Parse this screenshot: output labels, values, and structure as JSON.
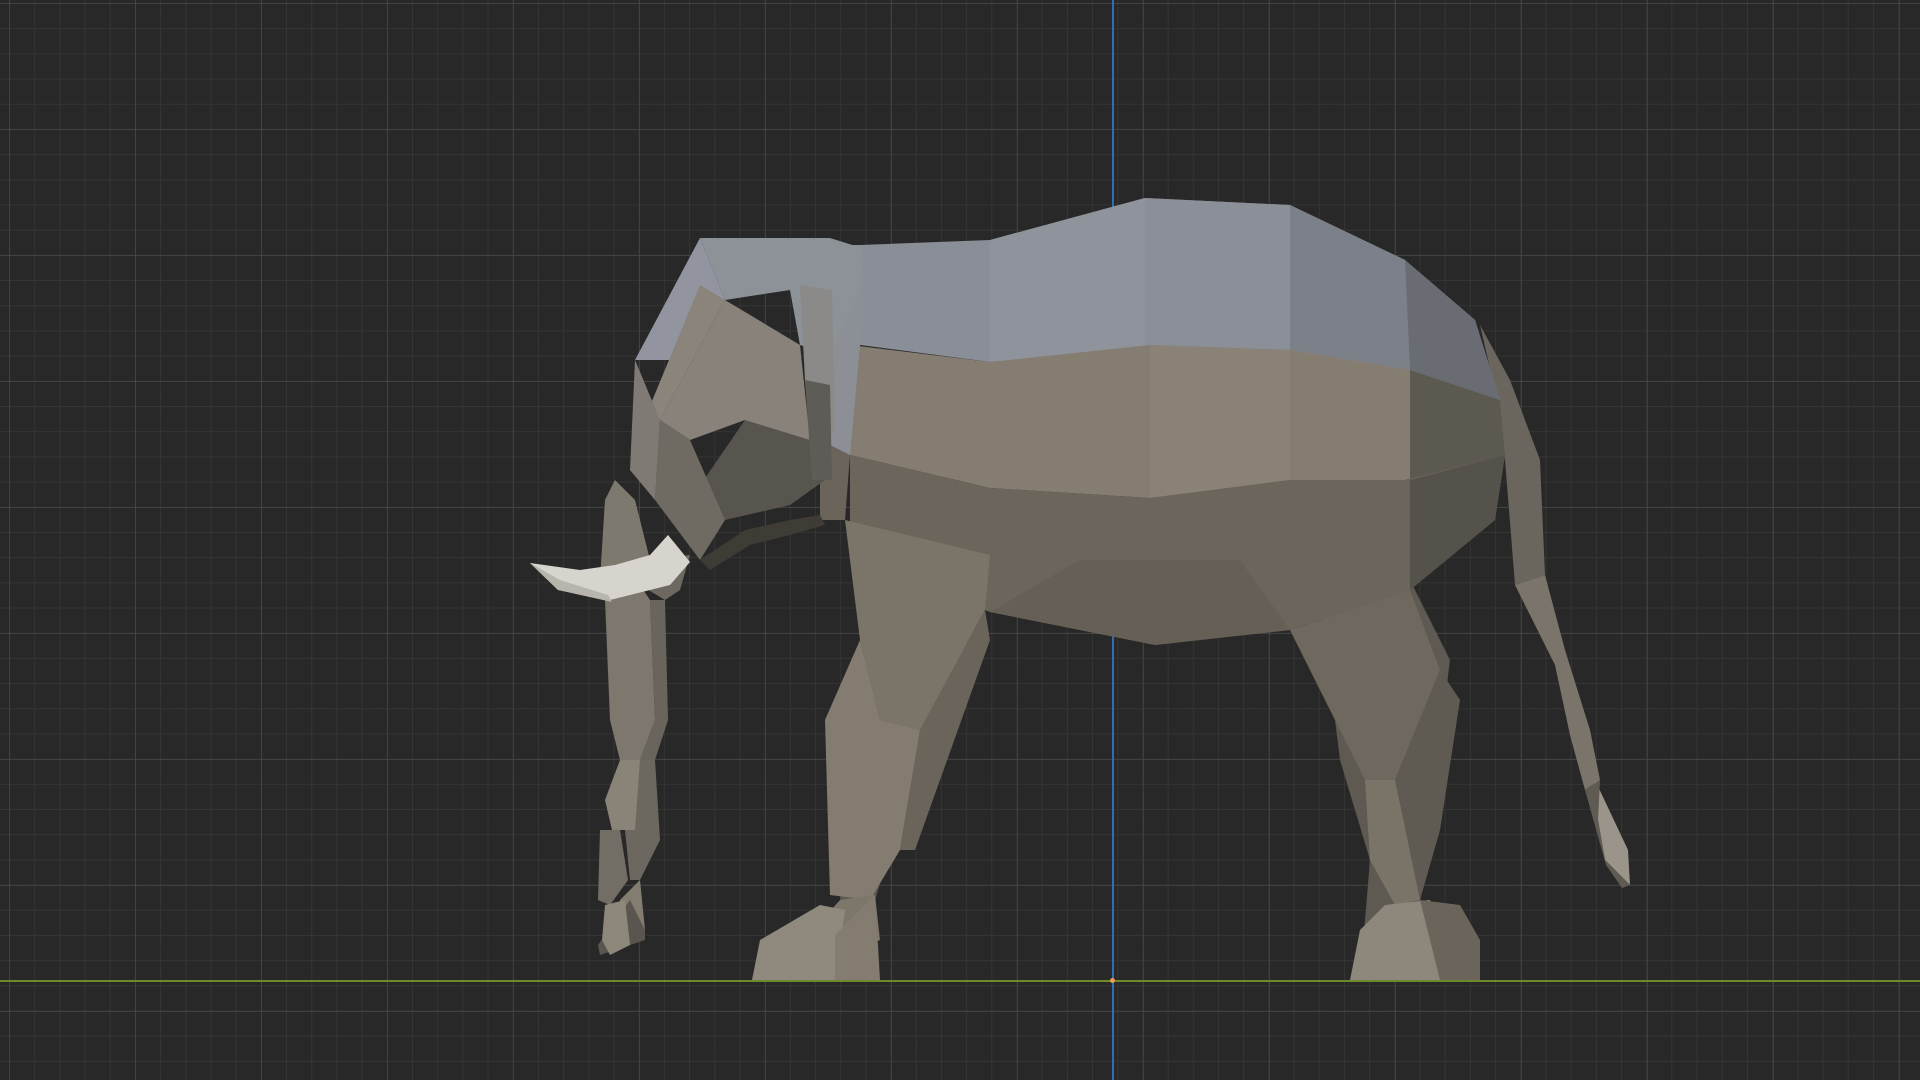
{
  "viewport": {
    "background_color": "#282828",
    "grid_major_color": "#4e4e4e",
    "grid_minor_color": "#363636",
    "axis_z_color": "#2e6fae",
    "axis_x_color": "#6f8a2a",
    "origin_color": "#e8a050"
  },
  "scene": {
    "object_icon": "elephant-lowpoly-mesh",
    "body_color": "#7d766c",
    "back_color": "#8a8e96",
    "tusk_color": "#d6d4cc"
  }
}
